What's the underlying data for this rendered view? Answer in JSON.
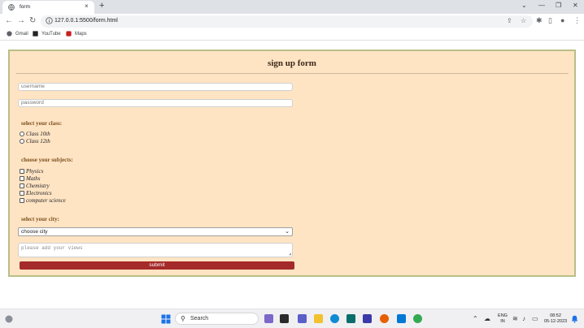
{
  "browser": {
    "tab_title": "form",
    "url": "127.0.0.1:5500/form.html",
    "bookmarks": [
      {
        "label": "Gmail"
      },
      {
        "label": "YouTube"
      },
      {
        "label": "Maps"
      }
    ]
  },
  "form": {
    "title": "sign up form",
    "username_placeholder": "username",
    "password_placeholder": "password",
    "class_label": "select your class:",
    "classes": [
      "Class 10th",
      "Class 12th"
    ],
    "subjects_label": "choose your subjects:",
    "subjects": [
      "Physics",
      "Maths",
      "Chemistry",
      "Electronics",
      "computer science"
    ],
    "city_label": "select your city:",
    "city_selected": "choose city",
    "views_placeholder": "please add your views",
    "submit_label": "submit"
  },
  "taskbar": {
    "search_label": "Search",
    "lang_line1": "ENG",
    "lang_line2": "IN",
    "time": "08:52",
    "date": "05-12-2023"
  },
  "colors": {
    "form_bg": "#ffe4c4",
    "form_border": "#b9bf87",
    "submit_bg": "#a52a2a",
    "label_color": "#7a4f1a"
  }
}
